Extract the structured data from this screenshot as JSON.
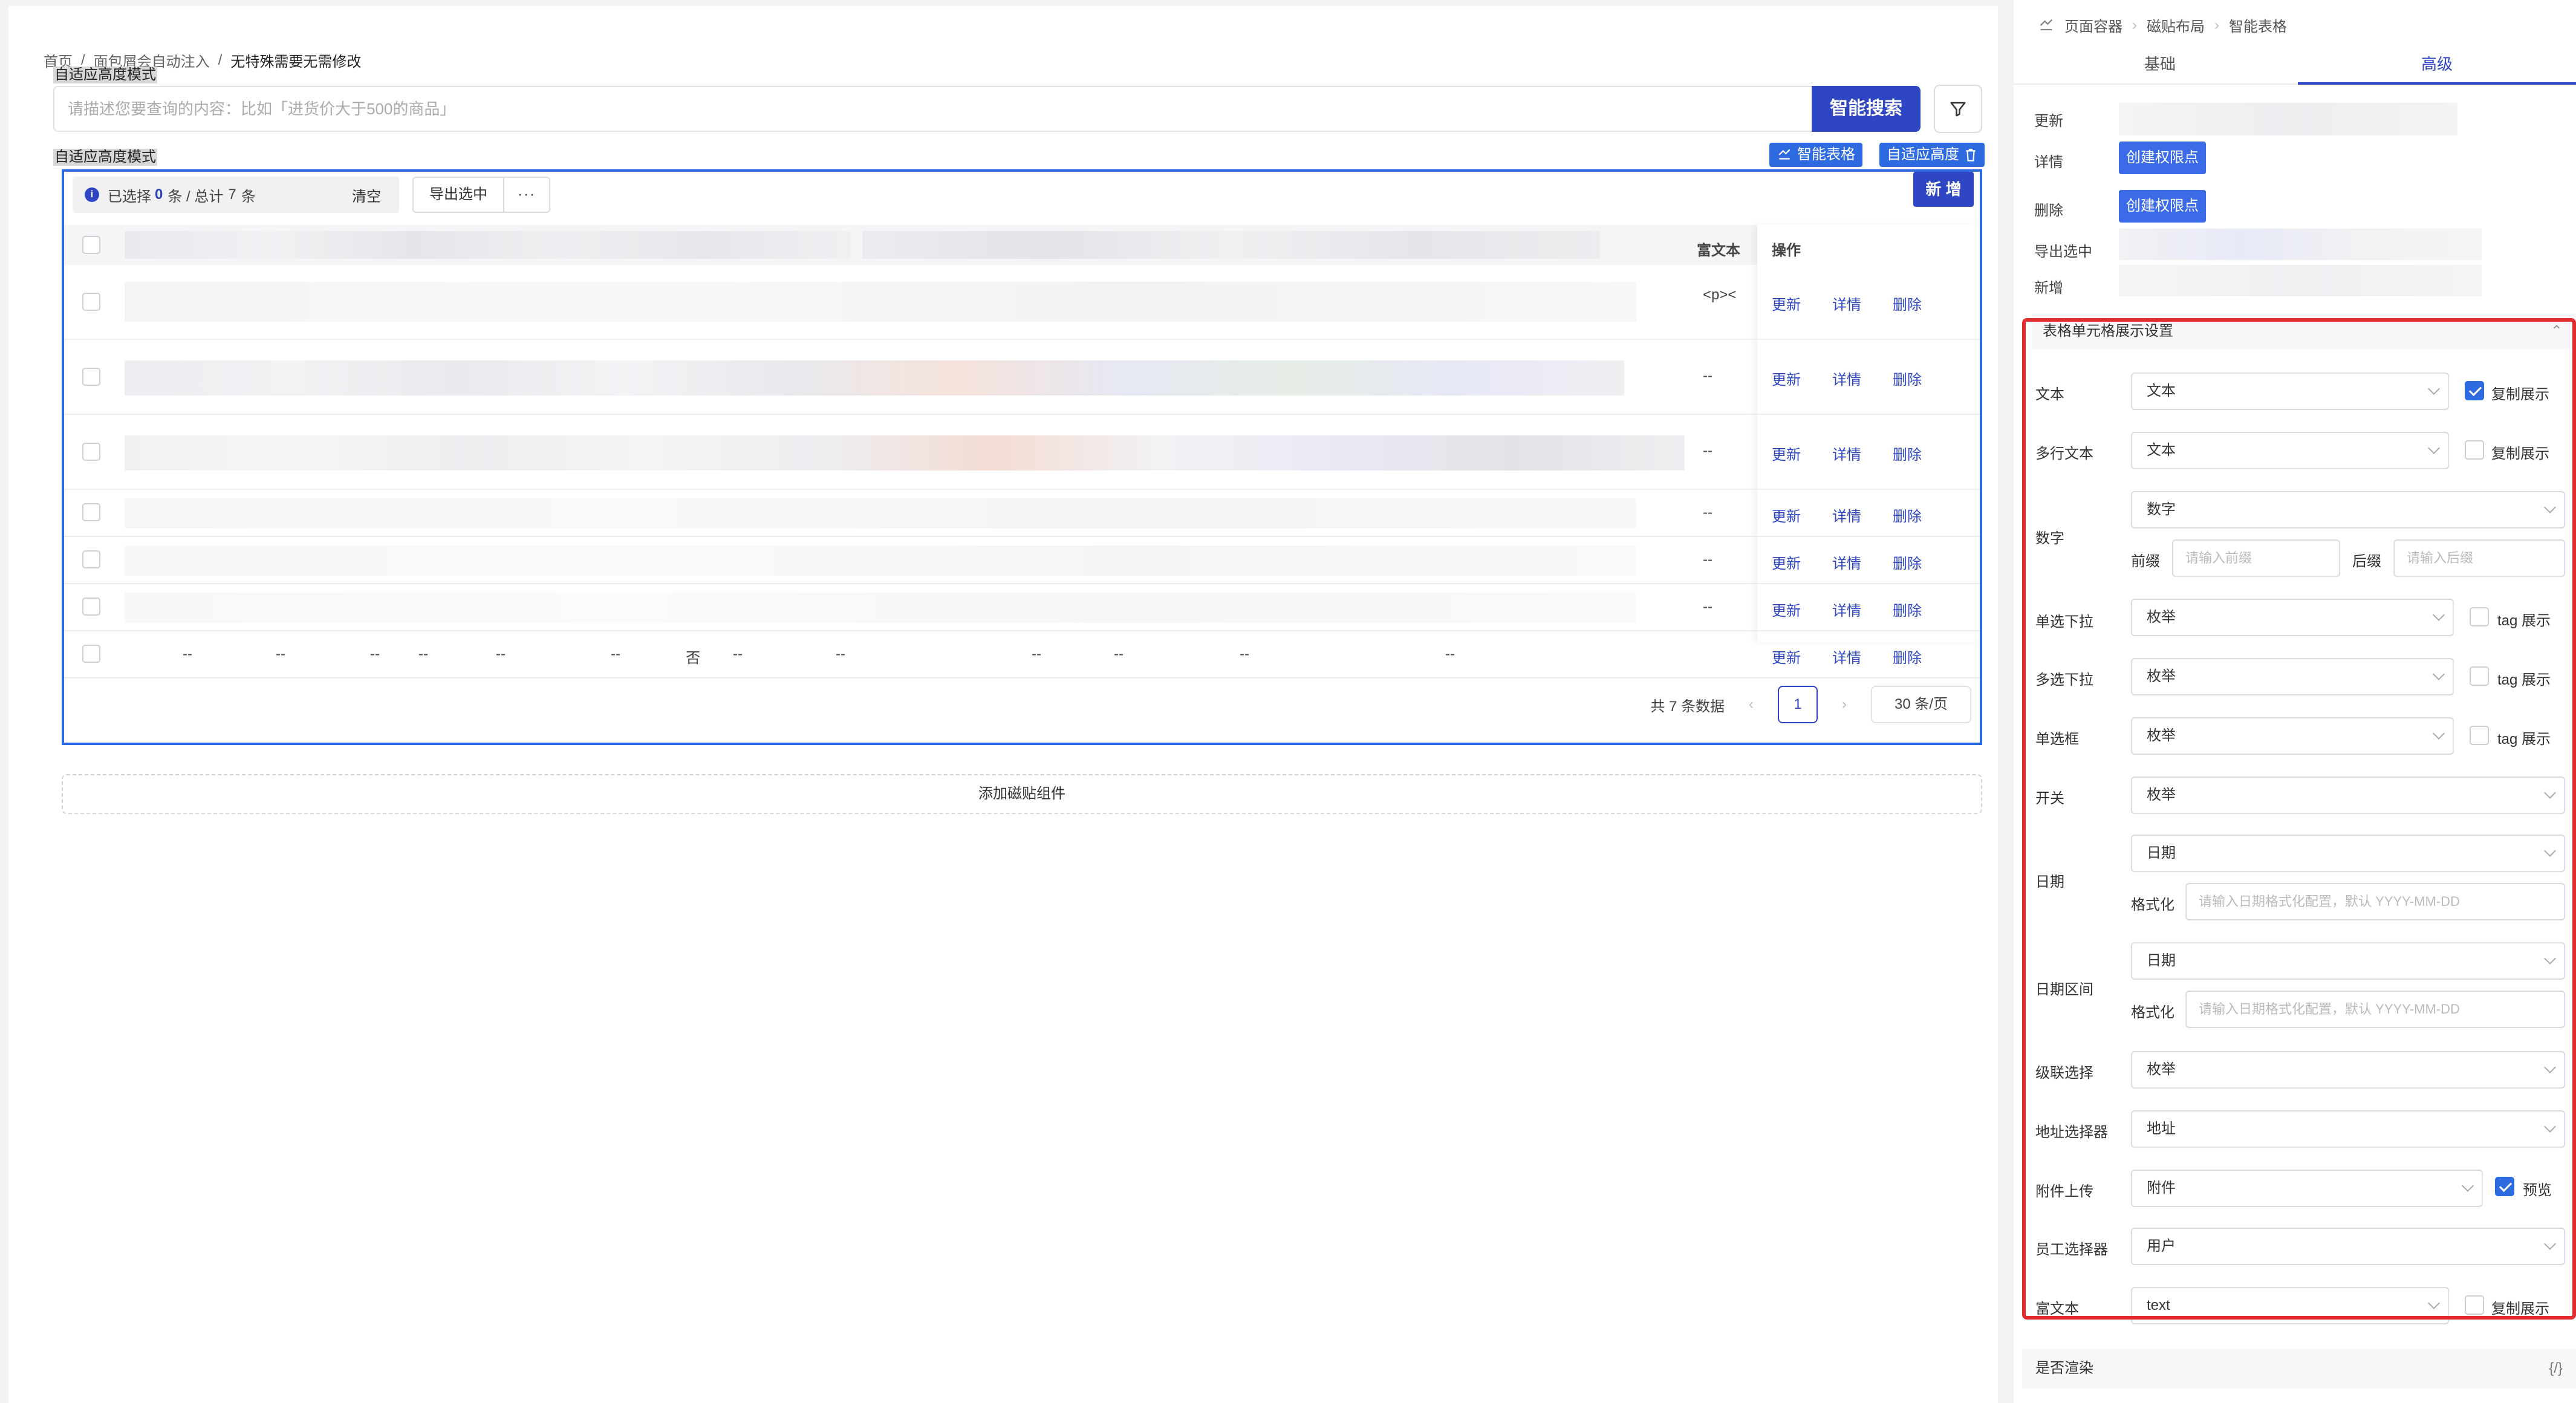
{
  "breadcrumb": [
    "首页",
    "/",
    "面包屑会自动注入",
    "/",
    "无特殊需要无需修改"
  ],
  "mode_label": "自适应高度模式",
  "search": {
    "placeholder": "请描述您要查询的内容：比如「进货价大于500的商品」",
    "button": "智能搜索"
  },
  "widget_tags": {
    "smart_table": "智能表格",
    "adaptive": "自适应高度"
  },
  "table": {
    "selection": {
      "prefix": "已选择",
      "count": "0",
      "mid": "条 / 总计",
      "total": "7",
      "suffix": "条",
      "clear": "清空"
    },
    "export_label": "导出选中",
    "more_label": "···",
    "new_label": "新 增",
    "header_richtext": "富文本",
    "header_ops": "操作",
    "ops": [
      "更新",
      "详情",
      "删除"
    ],
    "rich_row1": "<p><",
    "dash": "--",
    "last_row": [
      "--",
      "--",
      "--",
      "--",
      "--",
      "--",
      "否",
      "--",
      "--",
      "--",
      "--",
      "--",
      "--"
    ],
    "pager": {
      "total": "共 7 条数据",
      "page": "1",
      "size": "30 条/页"
    }
  },
  "add_block": "添加磁贴组件",
  "panel": {
    "crumb": [
      "页面容器",
      "磁贴布局",
      "智能表格"
    ],
    "tabs": [
      "基础",
      "高级"
    ],
    "perms": [
      {
        "label": "更新"
      },
      {
        "label": "详情",
        "button": "创建权限点"
      },
      {
        "label": "删除",
        "button": "创建权限点"
      },
      {
        "label": "导出选中"
      },
      {
        "label": "新增"
      }
    ],
    "section_title": "表格单元格展示设置",
    "settings": {
      "text": {
        "label": "文本",
        "value": "文本",
        "check": "复制展示"
      },
      "multiline": {
        "label": "多行文本",
        "value": "文本",
        "check": "复制展示"
      },
      "number": {
        "label": "数字",
        "value": "数字",
        "prefix_label": "前缀",
        "prefix_ph": "请输入前缀",
        "suffix_label": "后缀",
        "suffix_ph": "请输入后缀"
      },
      "single_select": {
        "label": "单选下拉",
        "value": "枚举",
        "check": "tag 展示"
      },
      "multi_select": {
        "label": "多选下拉",
        "value": "枚举",
        "check": "tag 展示"
      },
      "radio": {
        "label": "单选框",
        "value": "枚举",
        "check": "tag 展示"
      },
      "switch": {
        "label": "开关",
        "value": "枚举"
      },
      "date": {
        "label": "日期",
        "value": "日期",
        "fmt_label": "格式化",
        "fmt_ph": "请输入日期格式化配置，默认 YYYY-MM-DD"
      },
      "date_range": {
        "label": "日期区间",
        "value": "日期",
        "fmt_label": "格式化",
        "fmt_ph": "请输入日期格式化配置，默认 YYYY-MM-DD"
      },
      "cascader": {
        "label": "级联选择",
        "value": "枚举"
      },
      "address": {
        "label": "地址选择器",
        "value": "地址"
      },
      "attachment": {
        "label": "附件上传",
        "value": "附件",
        "check": "预览"
      },
      "employee": {
        "label": "员工选择器",
        "value": "用户"
      },
      "richtext": {
        "label": "富文本",
        "value": "text",
        "check": "复制展示"
      }
    },
    "render_label": "是否渲染",
    "render_code": "{/}"
  },
  "colors": {
    "primary": "#2f46c4",
    "link": "#2f6be0",
    "highlight": "#e12d2d"
  }
}
